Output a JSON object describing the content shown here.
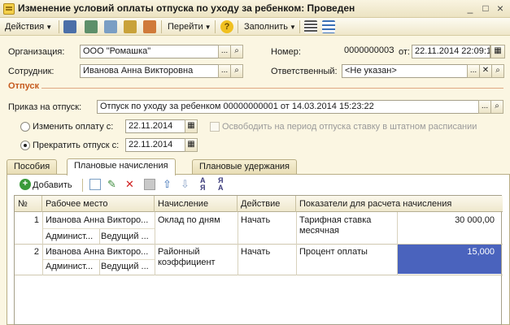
{
  "window": {
    "title": "Изменение условий оплаты отпуска по уходу за ребенком: Проведен",
    "minimize": "_",
    "maximize": "□",
    "close": "×"
  },
  "toolbar": {
    "actions_label": "Действия",
    "goto_label": "Перейти",
    "help_label": "?",
    "fill_label": "Заполнить"
  },
  "header": {
    "org_label": "Организация:",
    "org_value": "ООО \"Ромашка\"",
    "number_label": "Номер:",
    "number_value": "000000000З",
    "date_label": "от:",
    "date_value": "22.11.2014 22:09:1",
    "employee_label": "Сотрудник:",
    "employee_value": "Иванова Анна Викторовна",
    "responsible_label": "Ответственный:",
    "responsible_value": "<Не указан>"
  },
  "leave": {
    "section_title": "Отпуск",
    "order_label": "Приказ на отпуск:",
    "order_value": "Отпуск по уходу за ребенком 00000000001 от 14.03.2014 15:23:22",
    "change_pay_label": "Изменить оплату с:",
    "change_pay_date": "22.11.2014",
    "free_rate_label": "Освободить на период отпуска ставку в штатном расписании",
    "stop_leave_label": "Прекратить отпуск с:",
    "stop_leave_date": "22.11.2014"
  },
  "tabs": [
    {
      "label": "Пособия"
    },
    {
      "label": "Плановые начисления"
    },
    {
      "label": "Плановые удержания"
    }
  ],
  "subtoolbar": {
    "add_label": "Добавить"
  },
  "grid": {
    "columns": [
      "№",
      "Рабочее место",
      "Начисление",
      "Действие",
      "Показатели для расчета начисления"
    ],
    "rows": [
      {
        "num": "1",
        "employee": "Иванова Анна Викторо...",
        "dept": "Админист...",
        "position": "Ведущий ...",
        "accrual": "Оклад по дням",
        "action": "Начать",
        "indicator": "Тарифная ставка месячная",
        "indicator_line1": "Тарифная ставка",
        "indicator_line2": "месячная",
        "value": "30 000,00"
      },
      {
        "num": "2",
        "employee": "Иванова Анна Викторо...",
        "dept": "Админист...",
        "position": "Ведущий ...",
        "accrual": "Районный коэффициент",
        "accrual_line1": "Районный",
        "accrual_line2": "коэффициент",
        "action": "Начать",
        "indicator": "Процент оплаты",
        "value": "15,000"
      }
    ]
  },
  "colors": {
    "window_bg": "#fbf6e2",
    "section_title": "#c65a1e",
    "selected_cell": "#4a63bd"
  }
}
